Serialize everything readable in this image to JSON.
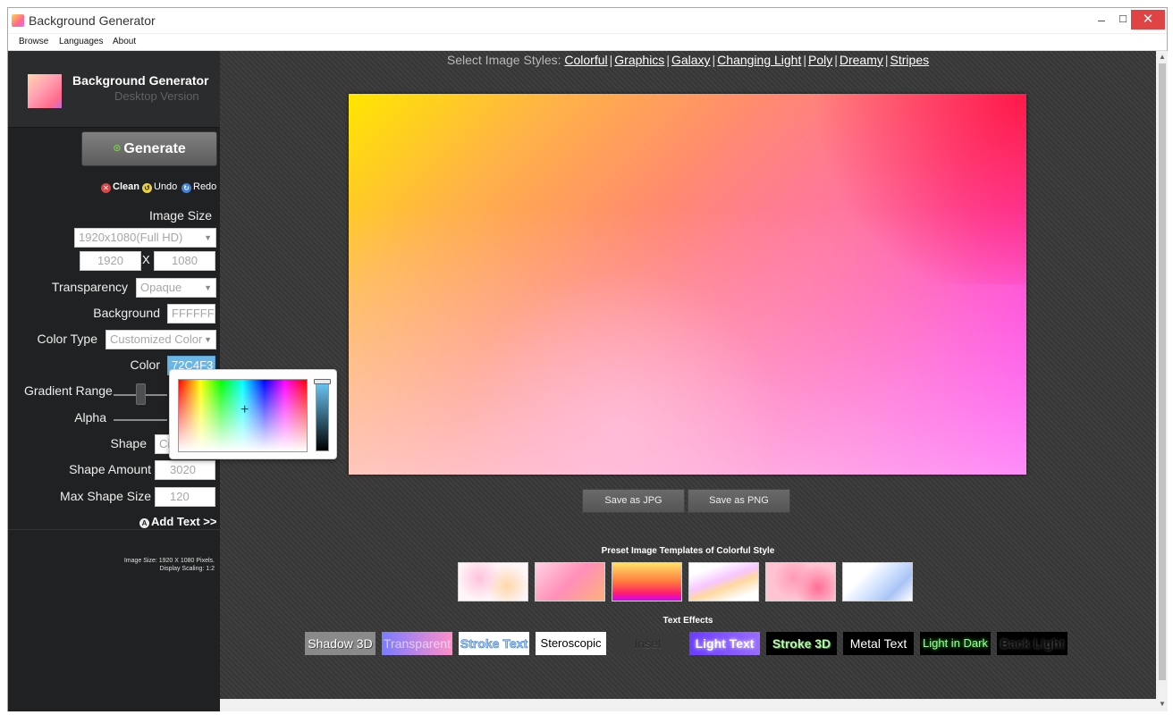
{
  "window": {
    "title": "Background Generator",
    "controls": {
      "minimize": "–",
      "maximize": "☐",
      "close": "✕"
    }
  },
  "menu": [
    "Browse",
    "Languages",
    "About"
  ],
  "sidebar": {
    "brand_title": "Background Generator",
    "brand_subtitle": "Desktop Version",
    "generate_label": "Generate",
    "actions": {
      "clean": "Clean",
      "undo": "Undo",
      "redo": "Redo"
    },
    "image_size_label": "Image Size",
    "image_size_value": "1920x1080(Full HD)",
    "width": "1920",
    "x_separator": "X",
    "height": "1080",
    "transparency_label": "Transparency",
    "transparency_value": "Opaque",
    "background_label": "Background",
    "background_value": "FFFFFF",
    "color_type_label": "Color Type",
    "color_type_value": "Customized Color",
    "color_label": "Color",
    "color_value": "72C4F3",
    "gradient_range_label": "Gradient Range",
    "alpha_label": "Alpha",
    "shape_label": "Shape",
    "shape_value": "Ci",
    "shape_amount_label": "Shape Amount",
    "shape_amount_value": "3020",
    "max_shape_size_label": "Max Shape Size",
    "max_shape_size_value": "120",
    "add_text_label": "Add Text >>",
    "info_line1": "Image Size: 1920 X 1080 Pixels.",
    "info_line2": "Display Scaling: 1:2"
  },
  "main": {
    "styles_prefix": "Select Image Styles:",
    "styles": [
      "Colorful",
      "Graphics",
      "Galaxy",
      "Changing Light",
      "Poly",
      "Dreamy",
      "Stripes"
    ],
    "save_jpg": "Save as JPG",
    "save_png": "Save as PNG",
    "preset_title": "Preset Image Templates of Colorful Style",
    "text_effects_title": "Text Effects",
    "text_effects": [
      "Shadow 3D",
      "Transparent",
      "Stroke Text",
      "Steroscopic",
      "Inset",
      "Light Text",
      "Stroke 3D",
      "Metal Text",
      "Light in Dark",
      "Back Light"
    ]
  },
  "colors": {
    "accent_color": "#72C4F3",
    "background_color": "#FFFFFF",
    "sidebar_bg": "#202122",
    "close_button": "#E04343"
  },
  "icons": {
    "generate": "circle-dot-icon",
    "clean": "x-circle-icon",
    "undo": "undo-circle-icon",
    "redo": "redo-circle-icon",
    "add_text": "add-text-icon"
  },
  "sliders": {
    "gradient_range_level": 0.3
  }
}
